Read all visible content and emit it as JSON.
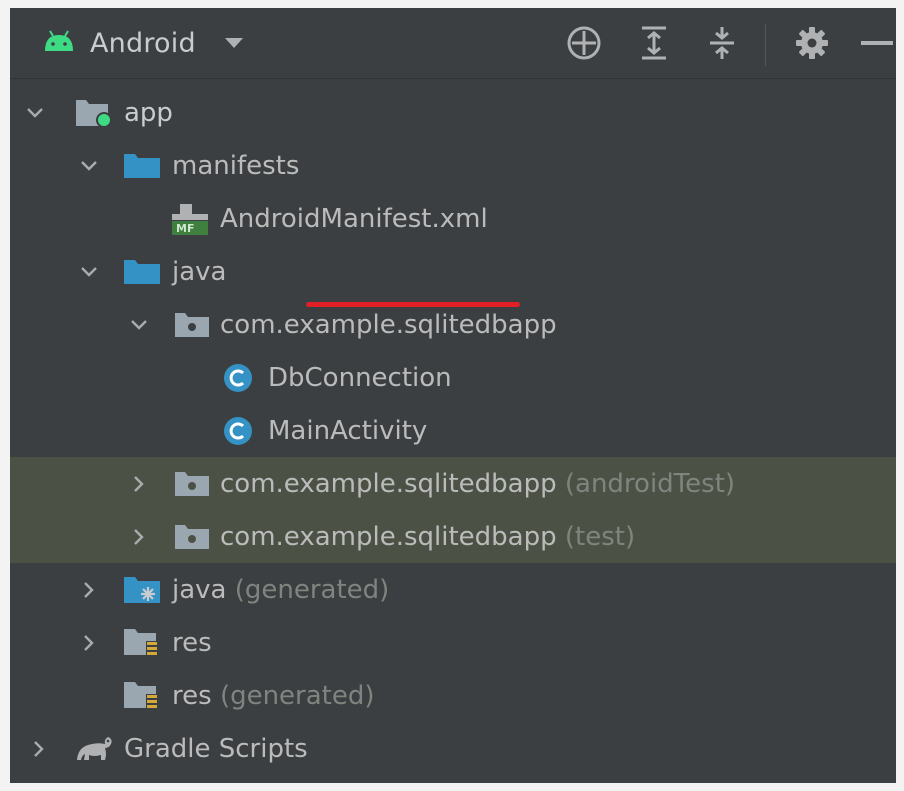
{
  "toolbar": {
    "view_name": "Android",
    "icons": [
      "android-icon",
      "dropdown-arrow-icon",
      "locate-icon",
      "expand-all-icon",
      "collapse-all-icon",
      "gear-icon",
      "minimize-icon"
    ]
  },
  "tree": {
    "rows": [
      {
        "label": "app",
        "hint": "",
        "state": "expanded",
        "icon": "module-folder-icon"
      },
      {
        "label": "manifests",
        "hint": "",
        "state": "expanded",
        "icon": "folder-icon"
      },
      {
        "label": "AndroidManifest.xml",
        "hint": "",
        "state": "leaf",
        "icon": "manifest-file-icon"
      },
      {
        "label": "java",
        "hint": "",
        "state": "expanded",
        "icon": "folder-icon"
      },
      {
        "label": "com.example.sqlitedbapp",
        "hint": "",
        "state": "expanded",
        "icon": "package-icon"
      },
      {
        "label": "DbConnection",
        "hint": "",
        "state": "leaf",
        "icon": "class-icon"
      },
      {
        "label": "MainActivity",
        "hint": "",
        "state": "leaf",
        "icon": "class-icon"
      },
      {
        "label": "com.example.sqlitedbapp",
        "hint": "(androidTest)",
        "state": "collapsed",
        "icon": "package-icon"
      },
      {
        "label": "com.example.sqlitedbapp",
        "hint": "(test)",
        "state": "collapsed",
        "icon": "package-icon"
      },
      {
        "label": "java",
        "hint": "(generated)",
        "state": "collapsed",
        "icon": "generated-folder-icon"
      },
      {
        "label": "res",
        "hint": "",
        "state": "collapsed",
        "icon": "resource-folder-icon"
      },
      {
        "label": "res",
        "hint": "(generated)",
        "state": "leaf",
        "icon": "resource-folder-icon"
      },
      {
        "label": "Gradle Scripts",
        "hint": "",
        "state": "collapsed",
        "icon": "gradle-icon"
      }
    ]
  },
  "colors": {
    "panel_bg": "#3c3f41",
    "highlight_row": "#4b5245",
    "text": "#bbbbbb",
    "hint_text": "#80847e",
    "folder_blue": "#3592c4",
    "android_green": "#3ddc84",
    "annotation_red": "#e01f26"
  }
}
